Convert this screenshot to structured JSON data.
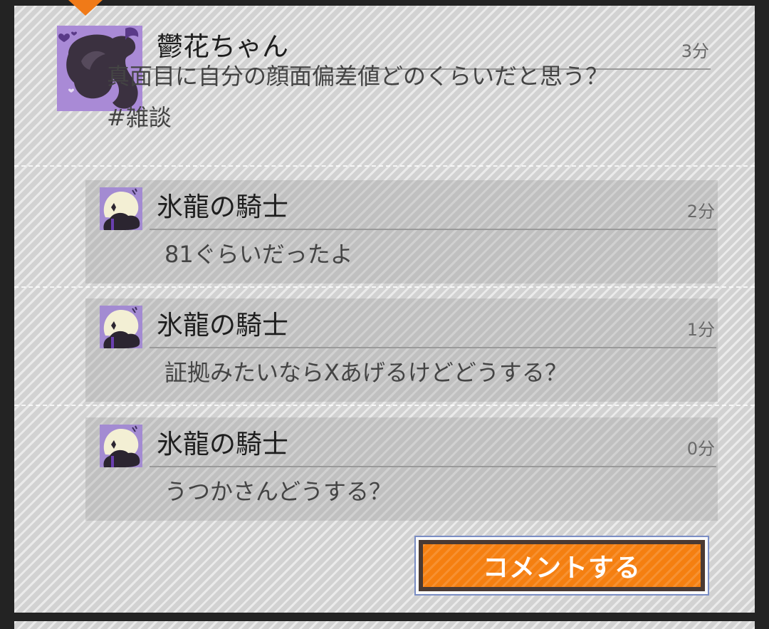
{
  "post": {
    "author": "鬱花ちゃん",
    "time": "3分",
    "text": "真面目に自分の顔面偏差値どのくらいだと思う？ #雑談",
    "avatar_icon": "twin-tail-girl-silhouette-icon"
  },
  "replies": [
    {
      "author": "氷龍の騎士",
      "time": "2分",
      "text": "81ぐらいだったよ",
      "avatar_icon": "white-hair-knight-avatar-icon"
    },
    {
      "author": "氷龍の騎士",
      "time": "1分",
      "text": "証拠みたいならXあげるけどどうする？",
      "avatar_icon": "white-hair-knight-avatar-icon"
    },
    {
      "author": "氷龍の騎士",
      "time": "0分",
      "text": "うつかさんどうする？",
      "avatar_icon": "white-hair-knight-avatar-icon"
    }
  ],
  "comment_button": {
    "label": "コメントする"
  },
  "colors": {
    "accent": "#f57f10",
    "avatar_bg": "#a98ad6",
    "panel": "#d2d2d2"
  }
}
